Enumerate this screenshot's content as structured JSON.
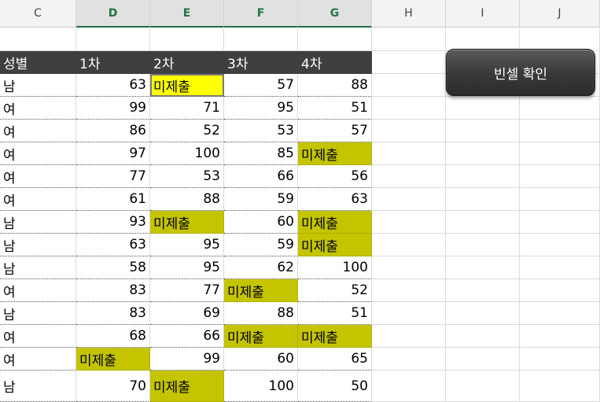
{
  "column_headers": [
    "C",
    "D",
    "E",
    "F",
    "G",
    "H",
    "I",
    "J"
  ],
  "selected_columns": [
    "D",
    "E",
    "F",
    "G"
  ],
  "table": {
    "headers": [
      "성별",
      "1차",
      "2차",
      "3차",
      "4차"
    ],
    "rows": [
      [
        "남",
        "63",
        "미제출",
        "57",
        "88"
      ],
      [
        "여",
        "99",
        "71",
        "95",
        "51"
      ],
      [
        "여",
        "86",
        "52",
        "53",
        "57"
      ],
      [
        "여",
        "97",
        "100",
        "85",
        "미제출"
      ],
      [
        "여",
        "77",
        "53",
        "66",
        "56"
      ],
      [
        "여",
        "61",
        "88",
        "59",
        "63"
      ],
      [
        "남",
        "93",
        "미제출",
        "60",
        "미제출"
      ],
      [
        "남",
        "63",
        "95",
        "59",
        "미제출"
      ],
      [
        "남",
        "58",
        "95",
        "62",
        "100"
      ],
      [
        "여",
        "83",
        "77",
        "미제출",
        "52"
      ],
      [
        "남",
        "83",
        "69",
        "88",
        "51"
      ],
      [
        "여",
        "68",
        "66",
        "미제출",
        "미제출"
      ],
      [
        "여",
        "미제출",
        "99",
        "60",
        "65"
      ],
      [
        "남",
        "70",
        "미제출",
        "100",
        "50"
      ]
    ],
    "blank_marker": "미제출"
  },
  "button": {
    "label": "빈셀 확인"
  },
  "colors": {
    "header_bg": "#3f3f3f",
    "blank_fill": "#c4c400",
    "active_fill": "#ffff00",
    "selected_header_text": "#217346"
  }
}
